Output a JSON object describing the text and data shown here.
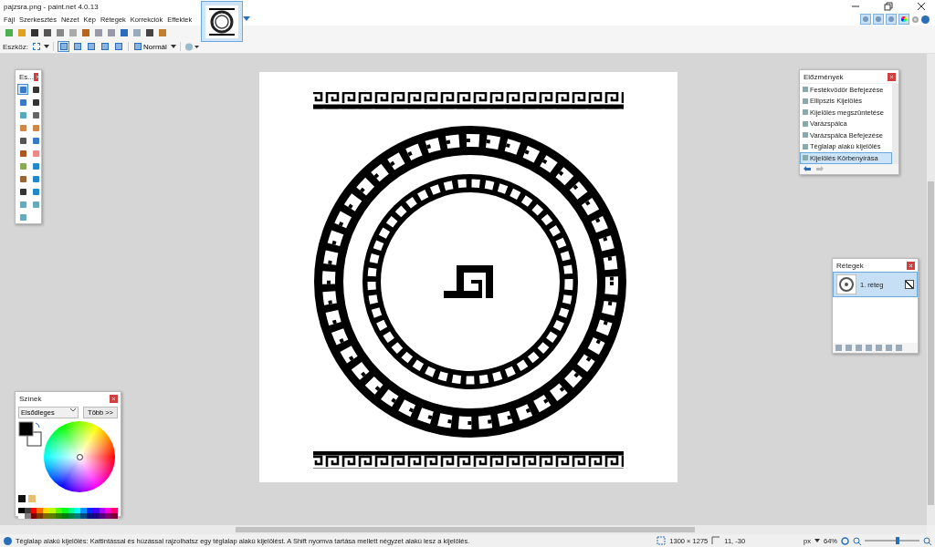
{
  "window": {
    "title": "pajzsra.png - paint.net 4.0.13"
  },
  "menu": [
    "Fájl",
    "Szerkesztés",
    "Nézet",
    "Kép",
    "Rétegek",
    "Korrekciók",
    "Effektek"
  ],
  "image_tab": {
    "selected": true
  },
  "panel_toggles": [
    {
      "selected": true
    },
    {
      "selected": true
    },
    {
      "selected": true
    },
    {
      "selected": true
    }
  ],
  "toolbar": {
    "tool_label": "Eszköz:",
    "selection_modes": [
      {
        "selected": true
      },
      {
        "selected": false
      },
      {
        "selected": false
      },
      {
        "selected": false
      },
      {
        "selected": false
      }
    ],
    "blend_mode": "Normál"
  },
  "tools_panel": {
    "title": "Es...",
    "tools": [
      {
        "selected": true
      },
      {
        "selected": false
      },
      {
        "selected": false
      },
      {
        "selected": false
      },
      {
        "selected": false
      },
      {
        "selected": false
      },
      {
        "selected": false
      },
      {
        "selected": false
      },
      {
        "selected": false
      },
      {
        "selected": false
      },
      {
        "selected": false
      },
      {
        "selected": false
      },
      {
        "selected": false
      },
      {
        "selected": false
      },
      {
        "selected": false
      },
      {
        "selected": false
      },
      {
        "selected": false
      },
      {
        "selected": false
      },
      {
        "selected": false
      },
      {
        "selected": false
      },
      {
        "selected": false
      }
    ]
  },
  "history": {
    "title": "Előzmények",
    "items": [
      {
        "label": "Festékvödör Befejezése",
        "selected": false
      },
      {
        "label": "Ellipszis Kijelölés",
        "selected": false
      },
      {
        "label": "Kijelölés megszüntetése",
        "selected": false
      },
      {
        "label": "Varázspálca",
        "selected": false
      },
      {
        "label": "Varázspálca Befejezése",
        "selected": false
      },
      {
        "label": "Téglalap alakú kijelölés",
        "selected": false
      },
      {
        "label": "Kijelölés Körbenyírása",
        "selected": true
      }
    ]
  },
  "layers": {
    "title": "Rétegek",
    "items": [
      {
        "name": "1. réteg",
        "visible": true,
        "selected": true
      }
    ]
  },
  "colors": {
    "title": "Színek",
    "mode": "Elsődleges",
    "more_button": "Több >>"
  },
  "status_bar": {
    "hint": "Téglalap alakú kijelölés: Kattintással és húzással rajzolhatsz egy téglalap alakú kijelölést. A Shift nyomva tartása mellett négyzet alakú lesz a kijelölés.",
    "image_size": "1300 × 1275",
    "cursor": "11, -30",
    "unit": "px",
    "zoom": "64%",
    "zoom_slider": {
      "level": 0.6
    }
  }
}
